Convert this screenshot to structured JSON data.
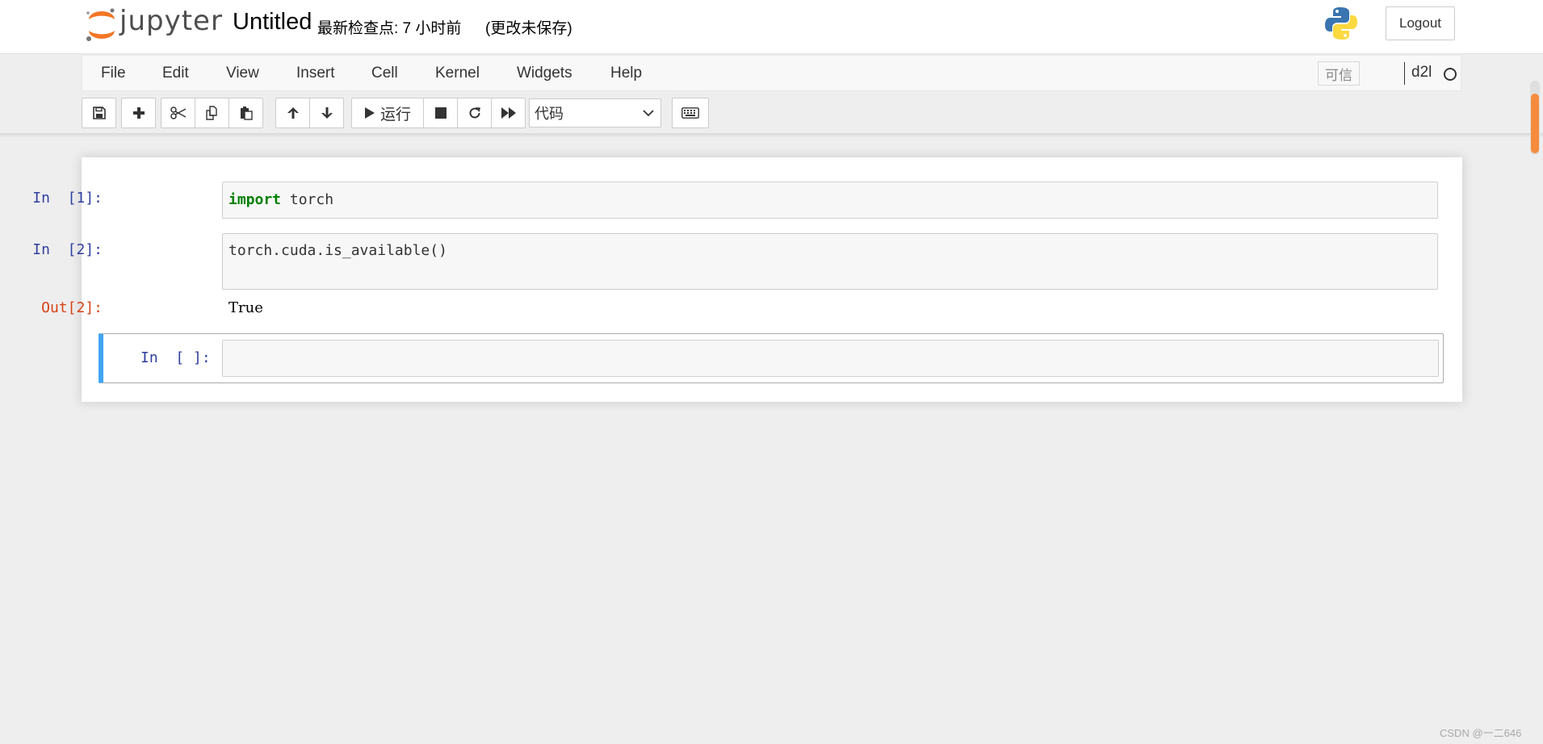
{
  "header": {
    "logo_text": "jupyter",
    "notebook_name": "Untitled",
    "checkpoint": "最新检查点: 7 小时前",
    "autosave_status": "(更改未保存)",
    "logout_label": "Logout"
  },
  "menubar": {
    "items": [
      "File",
      "Edit",
      "View",
      "Insert",
      "Cell",
      "Kernel",
      "Widgets",
      "Help"
    ],
    "trusted_label": "可信",
    "kernel_name": "d2l"
  },
  "toolbar": {
    "run_label": "运行",
    "cell_type": "代码",
    "icons": [
      "save-icon",
      "plus-icon",
      "cut-icon",
      "copy-icon",
      "paste-icon",
      "arrow-up-icon",
      "arrow-down-icon",
      "play-icon",
      "stop-icon",
      "restart-icon",
      "fast-forward-icon",
      "keyboard-icon"
    ]
  },
  "cells": [
    {
      "prompt": "In  [1]:",
      "keyword": "import",
      "code": " torch"
    },
    {
      "prompt": "In  [2]:",
      "code": "torch.cuda.is_available()",
      "out_prompt": "Out[2]:",
      "output": "True"
    },
    {
      "prompt": "In  [ ]:",
      "code": ""
    }
  ],
  "colors": {
    "accent_selected": "#42a5f5",
    "in_prompt": "#303f9f",
    "out_prompt": "#d84315",
    "keyword": "#008000",
    "logo_orange": "#f37626"
  },
  "watermark": "CSDN @一二646"
}
